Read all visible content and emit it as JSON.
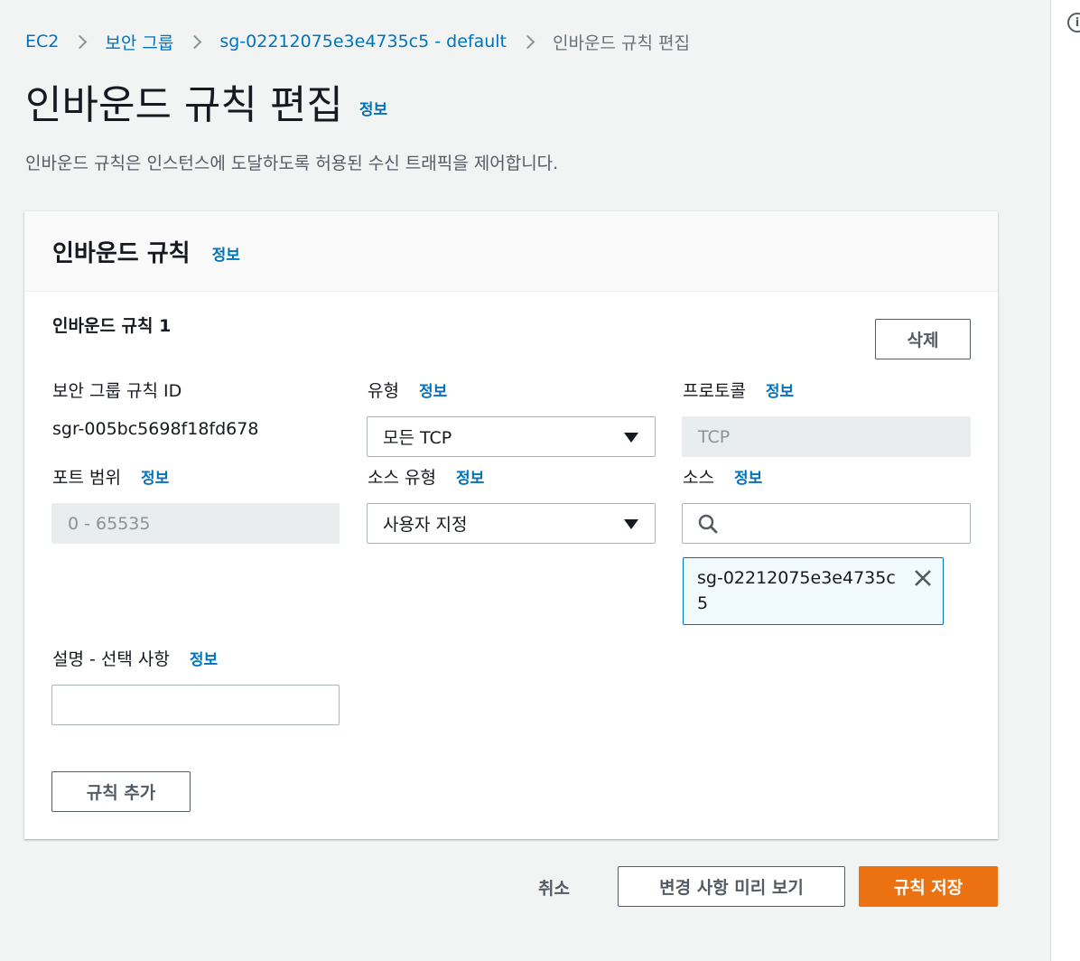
{
  "breadcrumb": {
    "items": [
      "EC2",
      "보안 그룹",
      "sg-02212075e3e4735c5 - default"
    ],
    "current": "인바운드 규칙 편집"
  },
  "page": {
    "title": "인바운드 규칙 편집",
    "info": "정보",
    "description": "인바운드 규칙은 인스턴스에 도달하도록 허용된 수신 트래픽을 제어합니다."
  },
  "panel": {
    "title": "인바운드 규칙",
    "info": "정보"
  },
  "rule": {
    "title": "인바운드 규칙 1",
    "delete_label": "삭제",
    "sg_rule_id_label": "보안 그룹 규칙 ID",
    "sg_rule_id_value": "sgr-005bc5698f18fd678",
    "type_label": "유형",
    "type_value": "모든 TCP",
    "protocol_label": "프로토콜",
    "protocol_value": "TCP",
    "port_label": "포트 범위",
    "port_value": "0 - 65535",
    "source_type_label": "소스 유형",
    "source_type_value": "사용자 지정",
    "source_label": "소스",
    "source_token": "sg-02212075e3e4735c5",
    "description_label": "설명 - 선택 사항",
    "info": "정보"
  },
  "actions": {
    "add_rule": "규칙 추가",
    "cancel": "취소",
    "preview": "변경 사항 미리 보기",
    "save": "규칙 저장"
  },
  "colors": {
    "link": "#0073bb",
    "primary": "#ec7211",
    "background": "#f2f3f3"
  }
}
